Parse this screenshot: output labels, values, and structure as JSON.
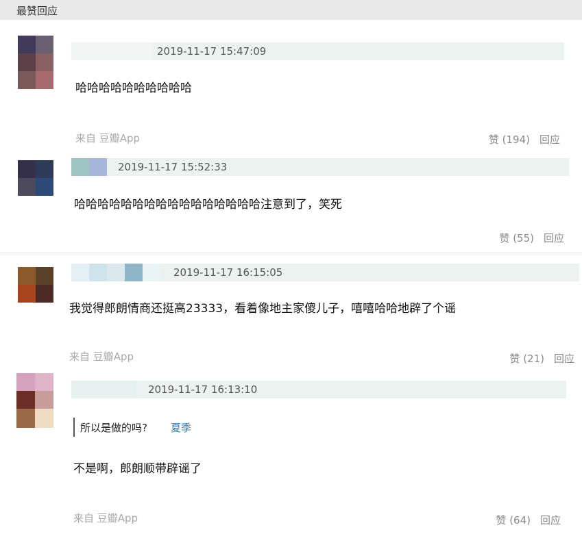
{
  "section": {
    "title": "最赞回应"
  },
  "comments": [
    {
      "time": "2019-11-17 15:47:09",
      "content": "哈哈哈哈哈哈哈哈哈哈",
      "source": "来自 豆瓣App",
      "like": "赞 (194)",
      "reply": "回应"
    },
    {
      "time": "2019-11-17 15:52:33",
      "content": "哈哈哈哈哈哈哈哈哈哈哈哈哈哈哈哈注意到了，笑死",
      "like": "赞 (55)",
      "reply": "回应"
    },
    {
      "time": "2019-11-17 16:15:05",
      "content": "我觉得郎朗情商还挺高23333，看着像地主家傻儿子，嘻嘻哈哈地辟了个谣",
      "source": "来自 豆瓣App",
      "like": "赞 (21)",
      "reply": "回应"
    },
    {
      "time": "2019-11-17 16:13:10",
      "quote": {
        "text": "所以是做的吗?",
        "author": "夏季"
      },
      "content": "不是啊，郎朗顺带辟谣了",
      "source": "来自 豆瓣App",
      "like": "赞 (64)",
      "reply": "回应"
    }
  ]
}
